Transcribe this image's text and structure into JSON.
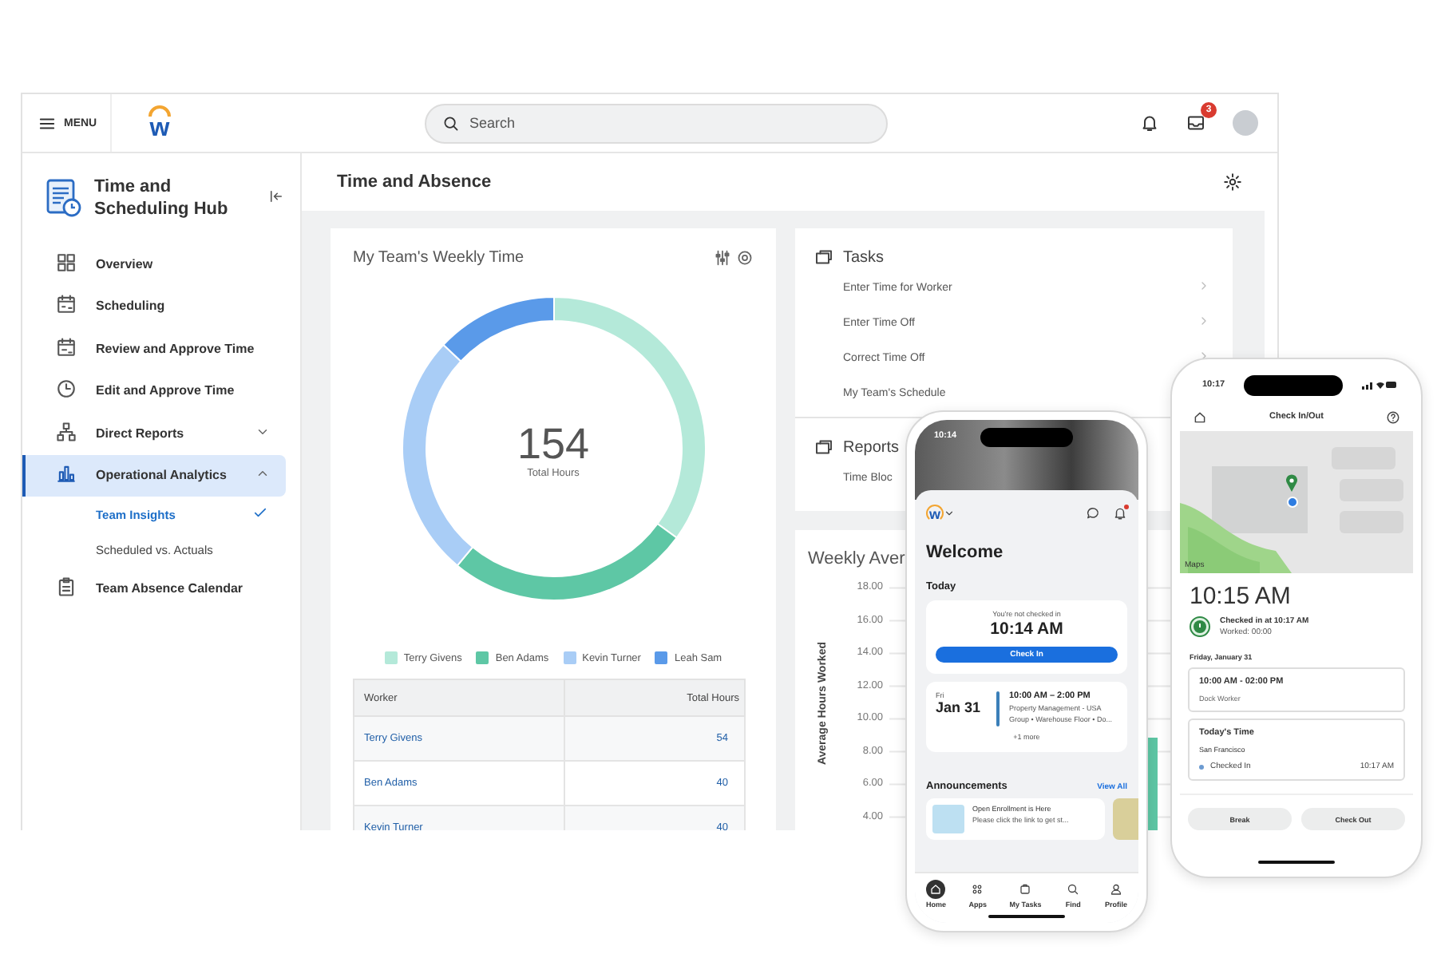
{
  "header": {
    "menu_label": "MENU",
    "logo_text": "w",
    "search": {
      "placeholder": "Search"
    },
    "mail_badge": "3"
  },
  "sidebar": {
    "title": "Time and Scheduling Hub",
    "items": [
      {
        "label": "Overview",
        "kind": "link",
        "selected": false
      },
      {
        "label": "Scheduling",
        "kind": "link",
        "selected": false
      },
      {
        "label": "Review and Approve Time",
        "kind": "link",
        "selected": false
      },
      {
        "label": "Edit and Approve Time",
        "kind": "link",
        "selected": false
      },
      {
        "label": "Direct Reports",
        "kind": "group",
        "selected": false,
        "expanded": false
      },
      {
        "label": "Operational Analytics",
        "kind": "group",
        "selected": true,
        "expanded": true,
        "children": [
          {
            "label": "Team Insights",
            "selected": true
          },
          {
            "label": "Scheduled vs. Actuals",
            "selected": false
          }
        ]
      },
      {
        "label": "Team Absence Calendar",
        "kind": "link",
        "selected": false
      }
    ]
  },
  "main": {
    "title": "Time and Absence",
    "weekly_time": {
      "title": "My Team's Weekly Time",
      "total": "154",
      "total_label": "Total Hours",
      "chart_data": {
        "type": "donut",
        "categories": [
          "Terry Givens",
          "Ben Adams",
          "Kevin Turner",
          "Leah Sam"
        ],
        "values": [
          35,
          26,
          26,
          13
        ],
        "colors": [
          "#b4e9d9",
          "#5ec7a5",
          "#a9cdf6",
          "#5a9ae9"
        ]
      },
      "table": {
        "columns": [
          "Worker",
          "Total Hours"
        ],
        "rows": [
          [
            "Terry Givens",
            "54"
          ],
          [
            "Ben Adams",
            "40"
          ],
          [
            "Kevin Turner",
            "40"
          ]
        ]
      }
    },
    "tasks": {
      "title": "Tasks",
      "items": [
        "Enter Time for Worker",
        "Enter Time Off",
        "Correct Time Off",
        "My Team's Schedule"
      ]
    },
    "reports": {
      "title": "Reports",
      "items": [
        "Time Bloc"
      ]
    },
    "weekly_average": {
      "title": "Weekly Aver",
      "y_axis_title": "Average Hours Worked",
      "y_tick_labels": [
        "18.00",
        "16.00",
        "14.00",
        "12.00",
        "10.00",
        "8.00",
        "6.00",
        "4.00"
      ]
    }
  },
  "phone_home": {
    "status_time": "10:14",
    "logo_text": "w",
    "greeting": "Welcome",
    "today_label": "Today",
    "checkin": {
      "status": "You're not checked in",
      "time": "10:14 AM",
      "button": "Check In"
    },
    "shift": {
      "day": "Fri",
      "date": "Jan 31",
      "time": "10:00 AM – 2:00 PM",
      "details": "Property Management - USA Group • Warehouse Floor • Do...",
      "more": "+1 more"
    },
    "announcements": {
      "title": "Announcements",
      "link": "View All",
      "items": [
        {
          "title": "Open Enrollment is Here",
          "body": "Please click the link to get st..."
        }
      ]
    },
    "nav": [
      {
        "label": "Home",
        "selected": true
      },
      {
        "label": "Apps",
        "selected": false
      },
      {
        "label": "My Tasks",
        "selected": false
      },
      {
        "label": "Find",
        "selected": false
      },
      {
        "label": "Profile",
        "selected": false
      }
    ]
  },
  "phone_checkin": {
    "status_time": "10:17",
    "title": "Check In/Out",
    "map_label": "Maps",
    "time": "10:15 AM",
    "status": "Checked in at 10:17 AM",
    "worked": "Worked: 00:00",
    "date": "Friday, January 31",
    "shift": {
      "time": "10:00 AM - 02:00 PM",
      "role": "Dock Worker"
    },
    "todays_time": {
      "title": "Today's Time",
      "location": "San Francisco",
      "entries": [
        {
          "label": "Checked In",
          "time": "10:17 AM"
        }
      ]
    },
    "buttons": [
      "Break",
      "Check Out"
    ]
  }
}
